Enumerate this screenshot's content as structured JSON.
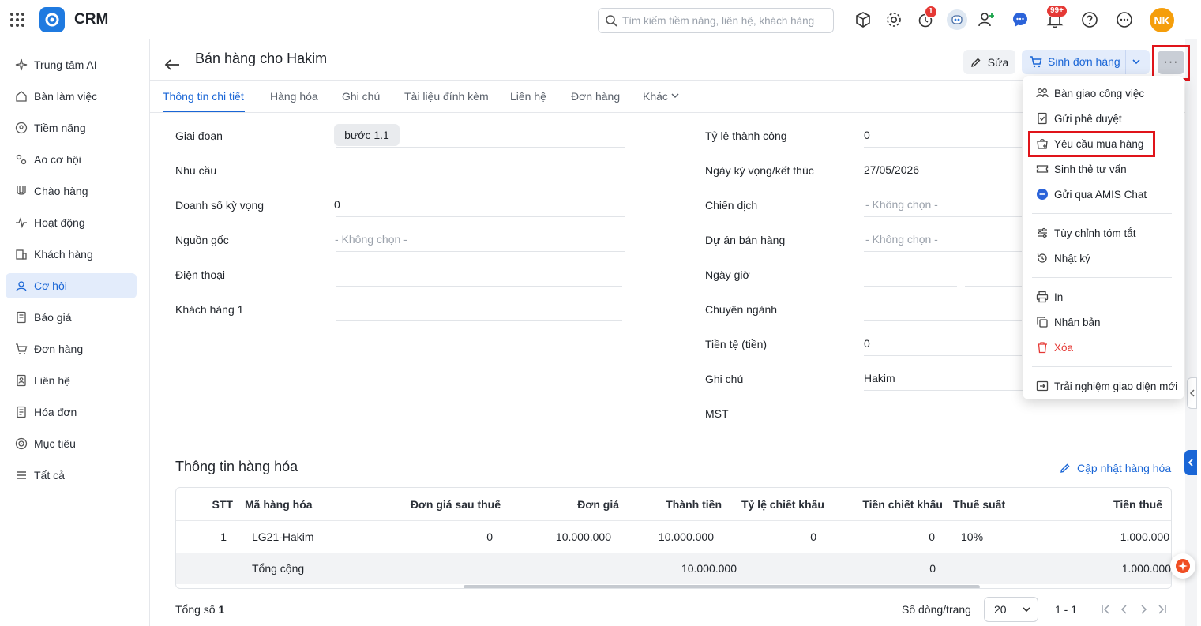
{
  "app": {
    "title": "CRM"
  },
  "search": {
    "placeholder": "Tìm kiếm tiềm năng, liên hệ, khách hàng"
  },
  "topbar": {
    "timer_badge": "1",
    "bell_badge": "99+",
    "avatar_initials": "NK",
    "icons": [
      "grid-apps-icon",
      "crm-logo-icon",
      "cube-icon",
      "gear-icon",
      "timer-icon",
      "robot-avatar-icon",
      "add-user-icon",
      "chat-icon",
      "bell-icon",
      "help-icon",
      "more-icon"
    ]
  },
  "sidebar": {
    "items": [
      {
        "label": "Trung tâm AI",
        "icon": "sparkle-icon"
      },
      {
        "label": "Bàn làm việc",
        "icon": "home-icon"
      },
      {
        "label": "Tiềm năng",
        "icon": "target-user-icon"
      },
      {
        "label": "Ao cơ hội",
        "icon": "pool-icon"
      },
      {
        "label": "Chào hàng",
        "icon": "magnet-icon"
      },
      {
        "label": "Hoạt động",
        "icon": "pulse-icon"
      },
      {
        "label": "Khách hàng",
        "icon": "building-icon"
      },
      {
        "label": "Cơ hội",
        "icon": "opportunity-icon",
        "active": true
      },
      {
        "label": "Báo giá",
        "icon": "quote-icon"
      },
      {
        "label": "Đơn hàng",
        "icon": "cart-icon"
      },
      {
        "label": "Liên hệ",
        "icon": "contact-icon"
      },
      {
        "label": "Hóa đơn",
        "icon": "invoice-icon"
      },
      {
        "label": "Mục tiêu",
        "icon": "goal-icon"
      },
      {
        "label": "Tất cả",
        "icon": "menu-icon"
      }
    ]
  },
  "header": {
    "title": "Bán hàng cho Hakim",
    "edit_label": "Sửa",
    "generate_order_label": "Sinh đơn hàng",
    "more_label": "···"
  },
  "tabs": [
    {
      "label": "Thông tin chi tiết",
      "active": true
    },
    {
      "label": "Hàng hóa"
    },
    {
      "label": "Ghi chú"
    },
    {
      "label": "Tài liệu đính kèm"
    },
    {
      "label": "Liên hệ"
    },
    {
      "label": "Đơn hàng"
    },
    {
      "label": "Khác"
    }
  ],
  "details": {
    "left": [
      {
        "label": "Giai đoạn",
        "value": "bước 1.1"
      },
      {
        "label": "Nhu cầu",
        "value": ""
      },
      {
        "label": "Doanh số kỳ vọng",
        "value": "0"
      },
      {
        "label": "Nguồn gốc",
        "value": "- Không chọn -"
      },
      {
        "label": "Điện thoại",
        "value": ""
      },
      {
        "label": "Khách hàng 1",
        "value": ""
      }
    ],
    "right": [
      {
        "label": "Tỷ lệ thành công",
        "value": "0"
      },
      {
        "label": "Ngày kỳ vọng/kết thúc",
        "value": "27/05/2026"
      },
      {
        "label": "Chiến dịch",
        "value": "- Không chọn -"
      },
      {
        "label": "Dự án bán hàng",
        "value": "- Không chọn -"
      },
      {
        "label": "Ngày giờ",
        "value": ""
      },
      {
        "label": "Chuyên ngành",
        "value": ""
      },
      {
        "label": "Tiền tệ (tiền)",
        "value": "0"
      },
      {
        "label": "Ghi chú",
        "value": "Hakim"
      },
      {
        "label": "MST",
        "value": ""
      }
    ]
  },
  "products": {
    "title": "Thông tin hàng hóa",
    "update_link": "Cập nhật hàng hóa",
    "columns": [
      "STT",
      "Mã hàng hóa",
      "Đơn giá sau thuế",
      "Đơn giá",
      "Thành tiền",
      "Tỷ lệ chiết khấu",
      "Tiền chiết khấu",
      "Thuế suất",
      "Tiền thuế"
    ],
    "rows": [
      [
        "1",
        "LG21-Hakim",
        "0",
        "10.000.000",
        "10.000.000",
        "0",
        "0",
        "10%",
        "1.000.000"
      ]
    ],
    "total": {
      "label": "Tổng cộng",
      "amount": "10.000.000",
      "discount": "0",
      "tax": "1.000.000"
    }
  },
  "footer": {
    "total_label": "Tổng số",
    "total_count": "1",
    "rows_per_page_label": "Số dòng/trang",
    "rows_per_page": "20",
    "range": "1 - 1"
  },
  "menu": {
    "items": [
      {
        "label": "Bàn giao công việc",
        "icon": "handover-icon"
      },
      {
        "label": "Gửi phê duyệt",
        "icon": "approval-icon"
      },
      {
        "label": "Yêu cầu mua hàng",
        "icon": "purchase-request-icon",
        "highlighted": true
      },
      {
        "label": "Sinh thẻ tư vấn",
        "icon": "ticket-icon"
      },
      {
        "label": "Gửi qua AMIS Chat",
        "icon": "amis-chat-icon"
      },
      {
        "label": "Tùy chỉnh tóm tắt",
        "icon": "sliders-icon"
      },
      {
        "label": "Nhật ký",
        "icon": "history-icon"
      },
      {
        "label": "In",
        "icon": "print-icon"
      },
      {
        "label": "Nhân bản",
        "icon": "duplicate-icon"
      },
      {
        "label": "Xóa",
        "icon": "trash-icon",
        "danger": true
      },
      {
        "label": "Trải nghiệm giao diện mới",
        "icon": "switch-ui-icon"
      }
    ]
  },
  "colors": {
    "primary": "#1a66d6",
    "danger": "#e53935",
    "highlight": "#e0141a",
    "avatar": "#f59e0b"
  }
}
